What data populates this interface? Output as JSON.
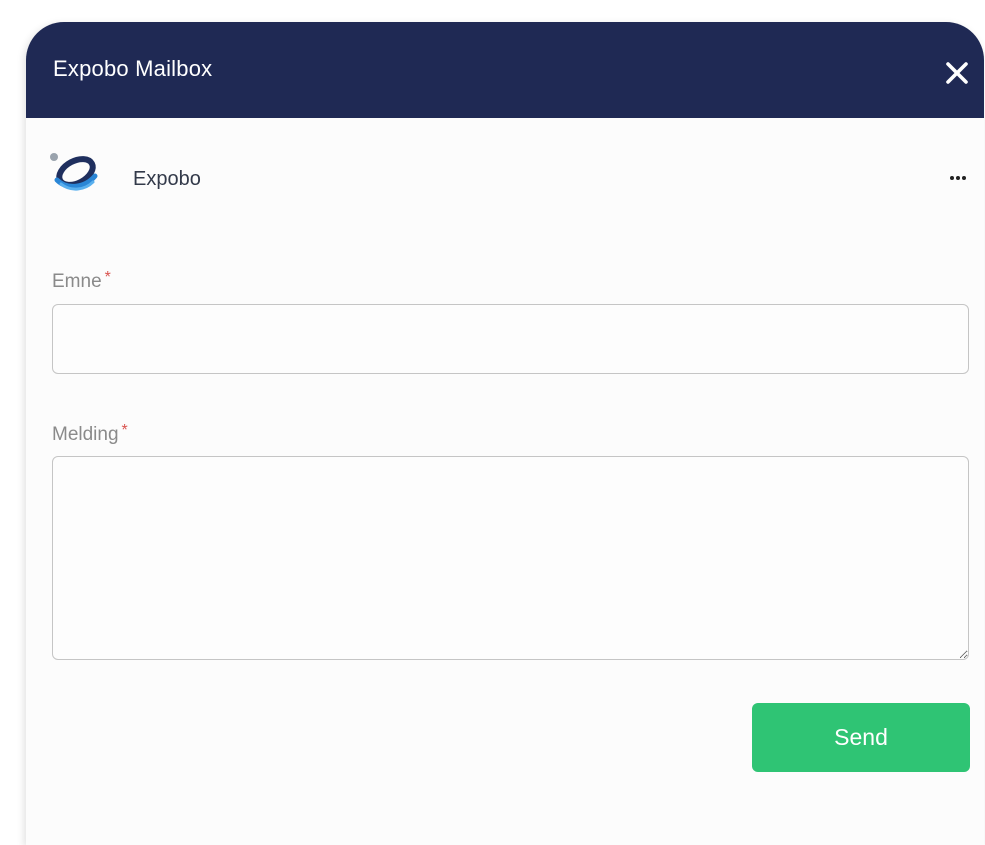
{
  "modal": {
    "title": "Expobo Mailbox",
    "close_icon": "close-icon"
  },
  "sender": {
    "name": "Expobo",
    "logo_icon": "expobo-logo",
    "more_icon": "more-horizontal-icon"
  },
  "form": {
    "subject_label": "Emne",
    "subject_value": "",
    "message_label": "Melding",
    "message_value": "",
    "required_marker": "*",
    "send_label": "Send"
  },
  "colors": {
    "header": "#1f2954",
    "send_button": "#2fc474",
    "required": "#d9534f"
  }
}
